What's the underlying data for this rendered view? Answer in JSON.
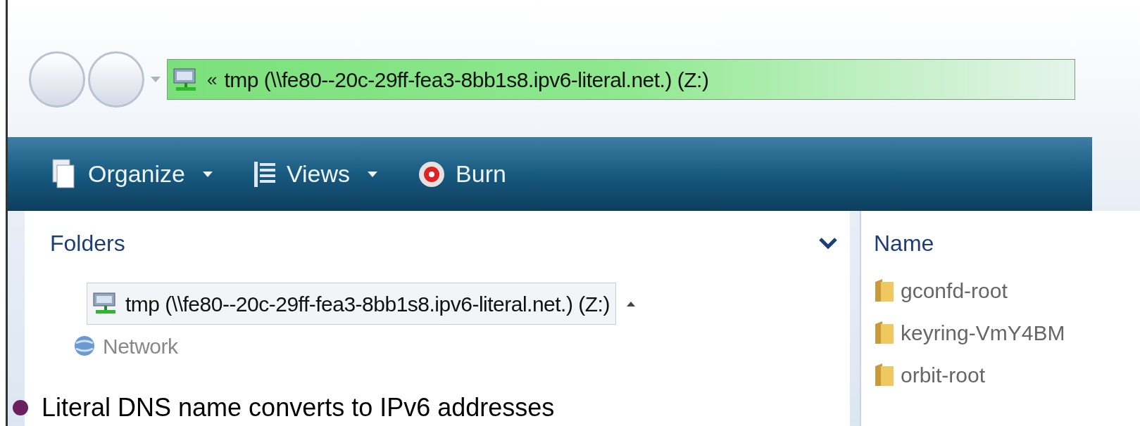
{
  "address_bar": {
    "overflow": "«",
    "path": "tmp (\\\\fe80--20c-29ff-fea3-8bb1s8.ipv6-literal.net.) (Z:)"
  },
  "toolbar": [
    {
      "label": "Organize",
      "has_menu": true
    },
    {
      "label": "Views",
      "has_menu": true
    },
    {
      "label": "Burn",
      "has_menu": false
    }
  ],
  "folders_pane": {
    "title": "Folders",
    "items": [
      {
        "label": "tmp (\\\\fe80--20c-29ff-fea3-8bb1s8.ipv6-literal.net.) (Z:)",
        "kind": "drive",
        "selected": true
      },
      {
        "label": "Network",
        "kind": "network",
        "selected": false
      }
    ]
  },
  "file_list": {
    "columns": [
      "Name"
    ],
    "rows": [
      "gconfd-root",
      "keyring-VmY4BM",
      "orbit-root"
    ]
  },
  "bullet": "Literal DNS name converts to IPv6 addresses"
}
